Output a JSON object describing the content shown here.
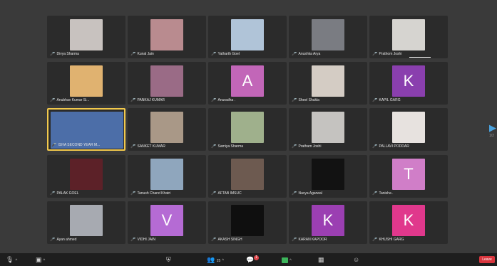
{
  "participants": [
    {
      "name": "Divya Sharma",
      "thumb": "photo",
      "color": "#c8c2bf"
    },
    {
      "name": "Kunal Jain",
      "thumb": "photo",
      "color": "#b98b8f"
    },
    {
      "name": "Yatharth Goel",
      "thumb": "photo",
      "color": "#b0c4d8"
    },
    {
      "name": "Anushka Arya",
      "thumb": "photo",
      "color": "#7a7c82"
    },
    {
      "name": "Prathom Joshi",
      "thumb": "photo",
      "color": "#d6d4d0",
      "speaking": true
    },
    {
      "name": "Anubhav Kumar Si...",
      "thumb": "photo",
      "color": "#e0b270"
    },
    {
      "name": "PANKAJ KUMAR",
      "thumb": "photo",
      "color": "#9a6b86"
    },
    {
      "name": "Anuradha .",
      "thumb": "A",
      "color": "#c266b8"
    },
    {
      "name": "Sheel Shukla",
      "thumb": "photo",
      "color": "#d4ccc4"
    },
    {
      "name": "KAPIL GARG",
      "thumb": "K",
      "color": "#8a3fae"
    },
    {
      "name": "ISHA SECOND YEAR M...",
      "thumb": "video",
      "color": "#4c6ea8",
      "active": true
    },
    {
      "name": "SANKET KUMAR",
      "thumb": "photo",
      "color": "#a99887"
    },
    {
      "name": "Samiya Sharma",
      "thumb": "photo",
      "color": "#9fb08c"
    },
    {
      "name": "Pratham Joshi",
      "thumb": "photo",
      "color": "#c5c3c0"
    },
    {
      "name": "PALLAVI PODDAR",
      "thumb": "photo",
      "color": "#e7e2df"
    },
    {
      "name": "PALAK GOEL",
      "thumb": "photo",
      "color": "#5c2128"
    },
    {
      "name": "Tanush Chand Khatri",
      "thumb": "photo",
      "color": "#8fa6bd"
    },
    {
      "name": "AFTAB IMSUC",
      "thumb": "photo",
      "color": "#6d5a50"
    },
    {
      "name": "Navya Agarwal",
      "thumb": "photo",
      "color": "#121212"
    },
    {
      "name": "Tanisha .",
      "thumb": "T",
      "color": "#d07ec8"
    },
    {
      "name": "Ayan ahmed",
      "thumb": "photo",
      "color": "#a7aab1"
    },
    {
      "name": "VIDHI JAIN",
      "thumb": "V",
      "color": "#b56bd4"
    },
    {
      "name": "AKASH SINGH",
      "thumb": "photo",
      "color": "#0f0f0f"
    },
    {
      "name": "KARAN KAPOOR",
      "thumb": "K",
      "color": "#9b3fb2"
    },
    {
      "name": "KHUSHI GARG",
      "thumb": "K",
      "color": "#e0388c"
    }
  ],
  "toolbar": {
    "participants_count": "25",
    "chat_badge": "1",
    "leave_label": "Leave"
  },
  "pager": {
    "indicator": "1/2"
  }
}
